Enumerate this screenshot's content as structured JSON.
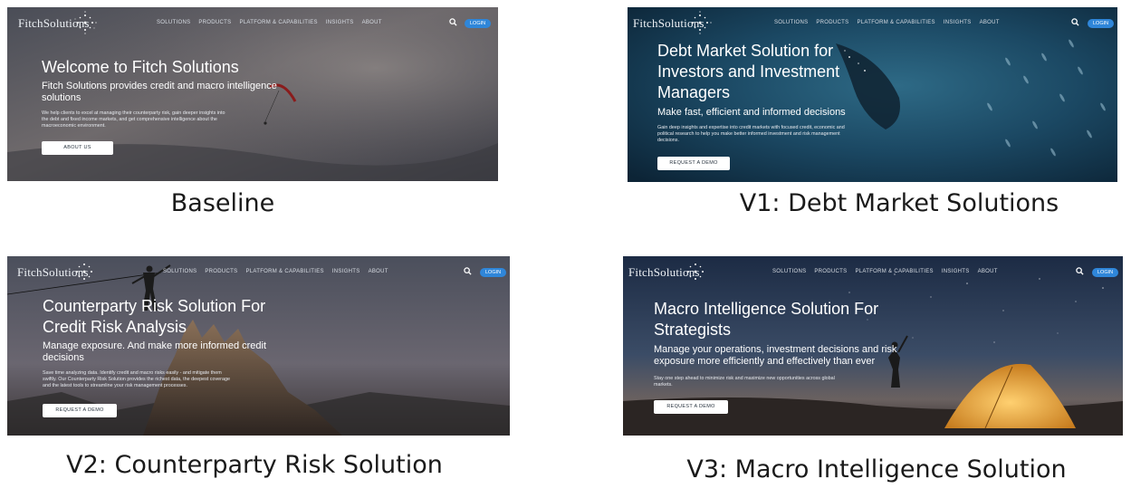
{
  "brand": {
    "logo_text": "FitchSolutions"
  },
  "nav": {
    "items": [
      "SOLUTIONS",
      "PRODUCTS",
      "PLATFORM & CAPABILITIES",
      "INSIGHTS",
      "ABOUT"
    ],
    "login": "LOGIN"
  },
  "variants": [
    {
      "caption": "Baseline",
      "title": "Welcome to Fitch Solutions",
      "subtitle": "Fitch Solutions provides credit and macro intelligence\nsolutions",
      "body": "We help clients to excel at managing their counterparty risk, gain deeper insights into\nthe debt and fixed income markets, and get comprehensive intelligence about the\nmacroeconomic environment.",
      "cta": "ABOUT US"
    },
    {
      "caption": "V1: Debt Market Solutions",
      "title": "Debt Market Solution for\nInvestors and Investment\nManagers",
      "subtitle": "Make fast, efficient and informed decisions",
      "body": "Gain deep insights and expertise into credit markets with focused credit, economic and\npolitical research to help you make better informed investment and risk management\ndecisions.",
      "cta": "REQUEST A DEMO"
    },
    {
      "caption": "V2: Counterparty Risk Solution",
      "title": "Counterparty Risk Solution For\nCredit Risk Analysis",
      "subtitle": "Manage exposure. And make more informed credit\ndecisions",
      "body": "Save time analyzing data. Identify credit and macro risks easily - and mitigate them\nswiftly. Our Counterparty Risk Solution provides the richest data, the deepest coverage\nand the latest tools to streamline your risk management processes.",
      "cta": "REQUEST A DEMO"
    },
    {
      "caption": "V3: Macro Intelligence Solution",
      "title": "Macro Intelligence Solution For\nStrategists",
      "subtitle": "Manage your operations, investment decisions and risk\nexposure more efficiently and effectively than ever",
      "body": "Stay one step ahead to minimize risk and maximize new opportunities across global\nmarkets.",
      "cta": "REQUEST A DEMO"
    }
  ]
}
